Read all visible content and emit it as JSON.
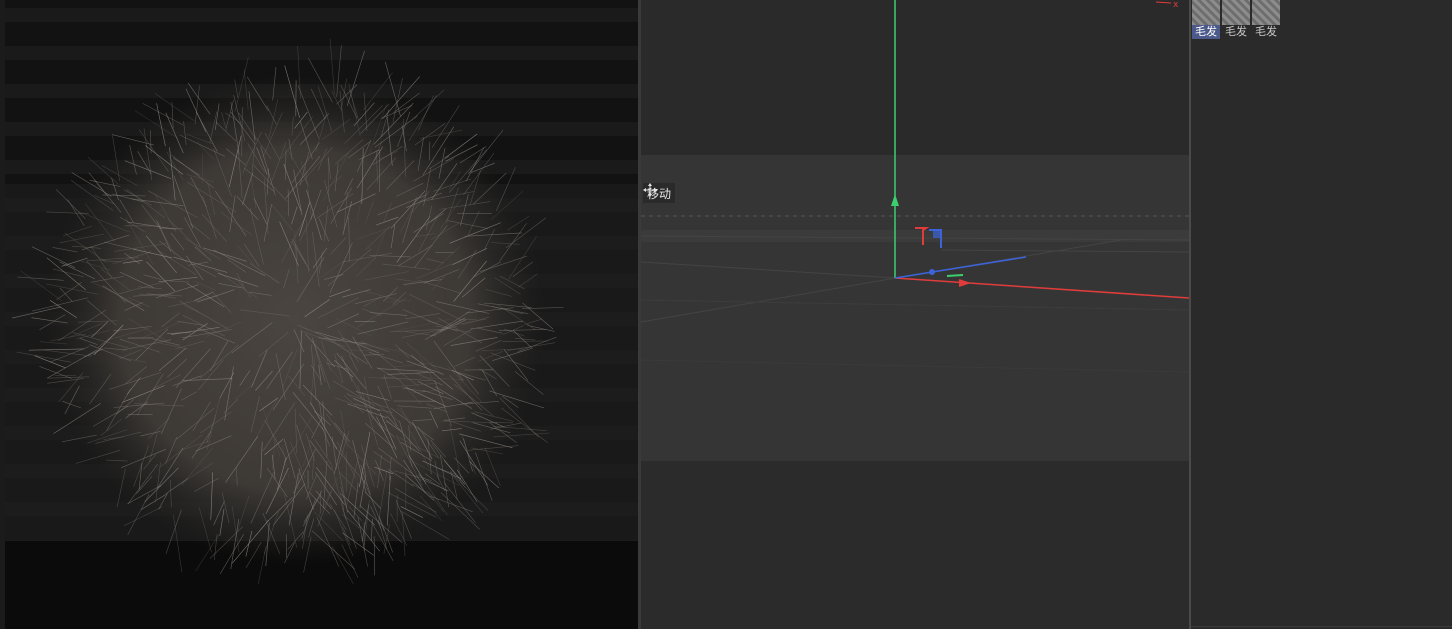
{
  "viewport": {
    "tool_label": "移动",
    "tool_icon": "move-icon",
    "axis_colors": {
      "x": "#e03c3c",
      "y": "#3ccf6e",
      "z": "#3c64d8"
    }
  },
  "render": {
    "subject": "fur-ball-icon"
  },
  "materials": {
    "items": [
      {
        "label": "毛发",
        "selected": true
      },
      {
        "label": "毛发",
        "selected": false
      },
      {
        "label": "毛发",
        "selected": false
      }
    ]
  }
}
